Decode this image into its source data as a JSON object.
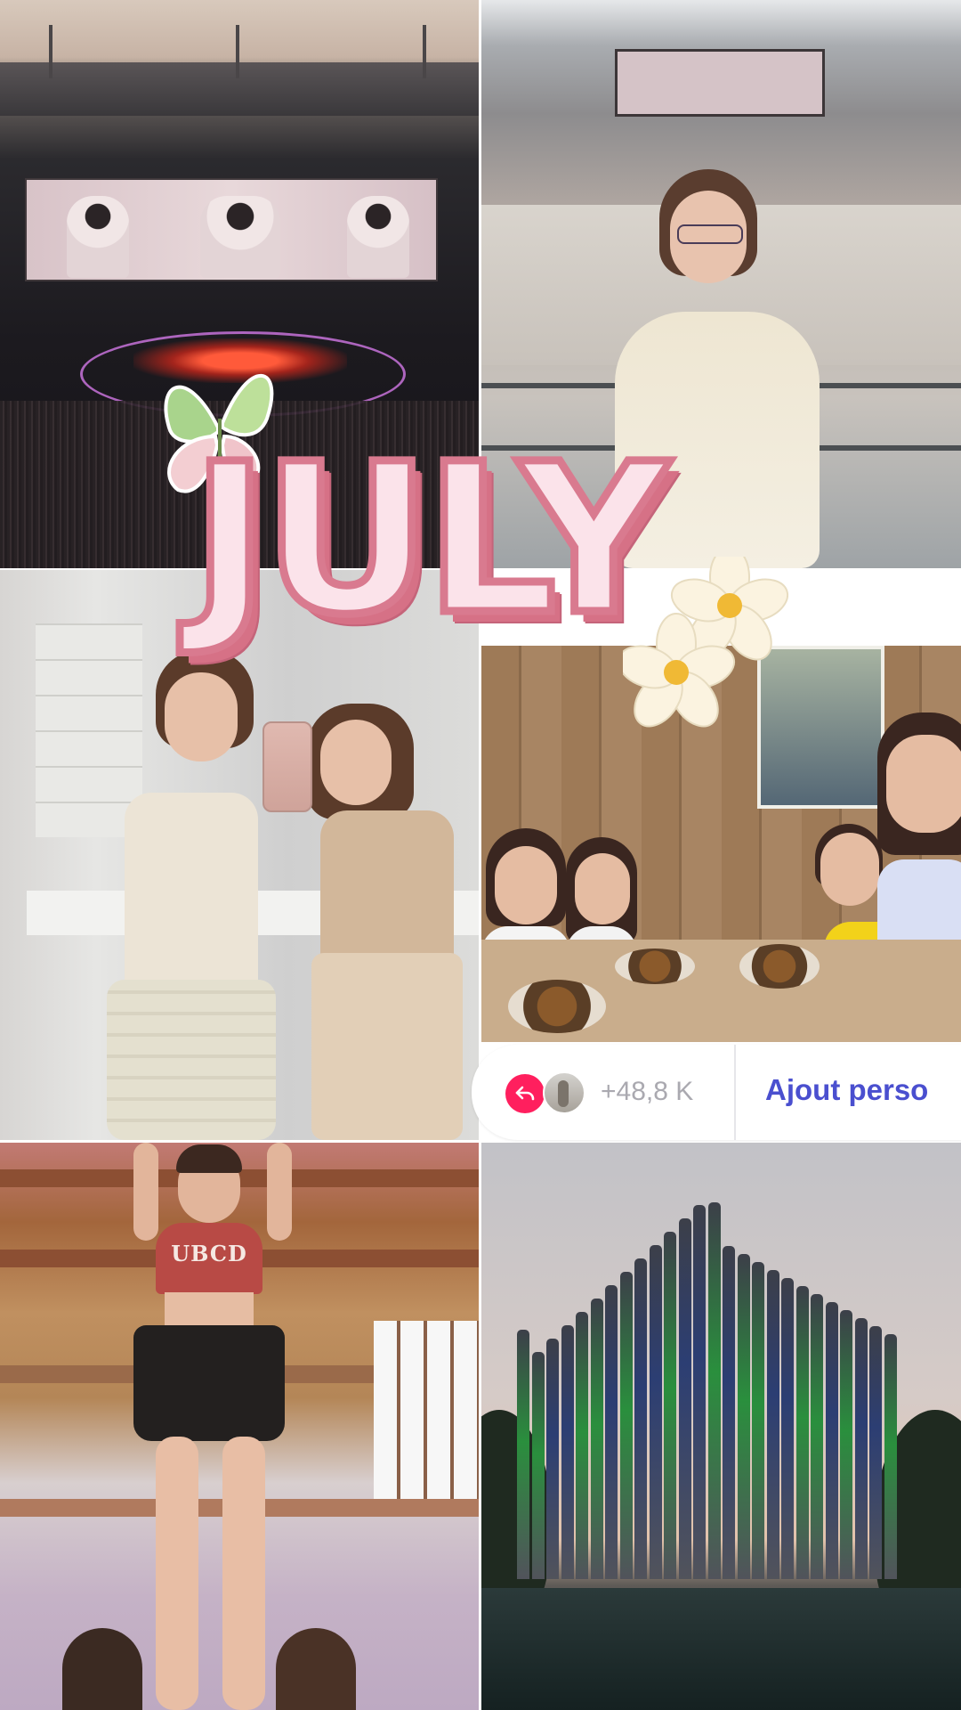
{
  "collage": {
    "title_text": "JULY",
    "photos": [
      {
        "name": "concert-stage"
      },
      {
        "name": "stadium-portrait"
      },
      {
        "name": "mirror-selfie"
      },
      {
        "name": "restaurant-group"
      },
      {
        "name": "cheer-stunt",
        "shirt_text": "UBCD"
      },
      {
        "name": "organ-building-dusk"
      }
    ]
  },
  "action_bar": {
    "back_icon": "reply-arrow-icon",
    "count": "+48,8 K",
    "cta_label": "Ajout perso"
  },
  "colors": {
    "accent_pink": "#ff1f5e",
    "cta_blue": "#4a4fcf",
    "title_fill": "#fbe3ea",
    "title_stroke": "#d97a8f"
  }
}
